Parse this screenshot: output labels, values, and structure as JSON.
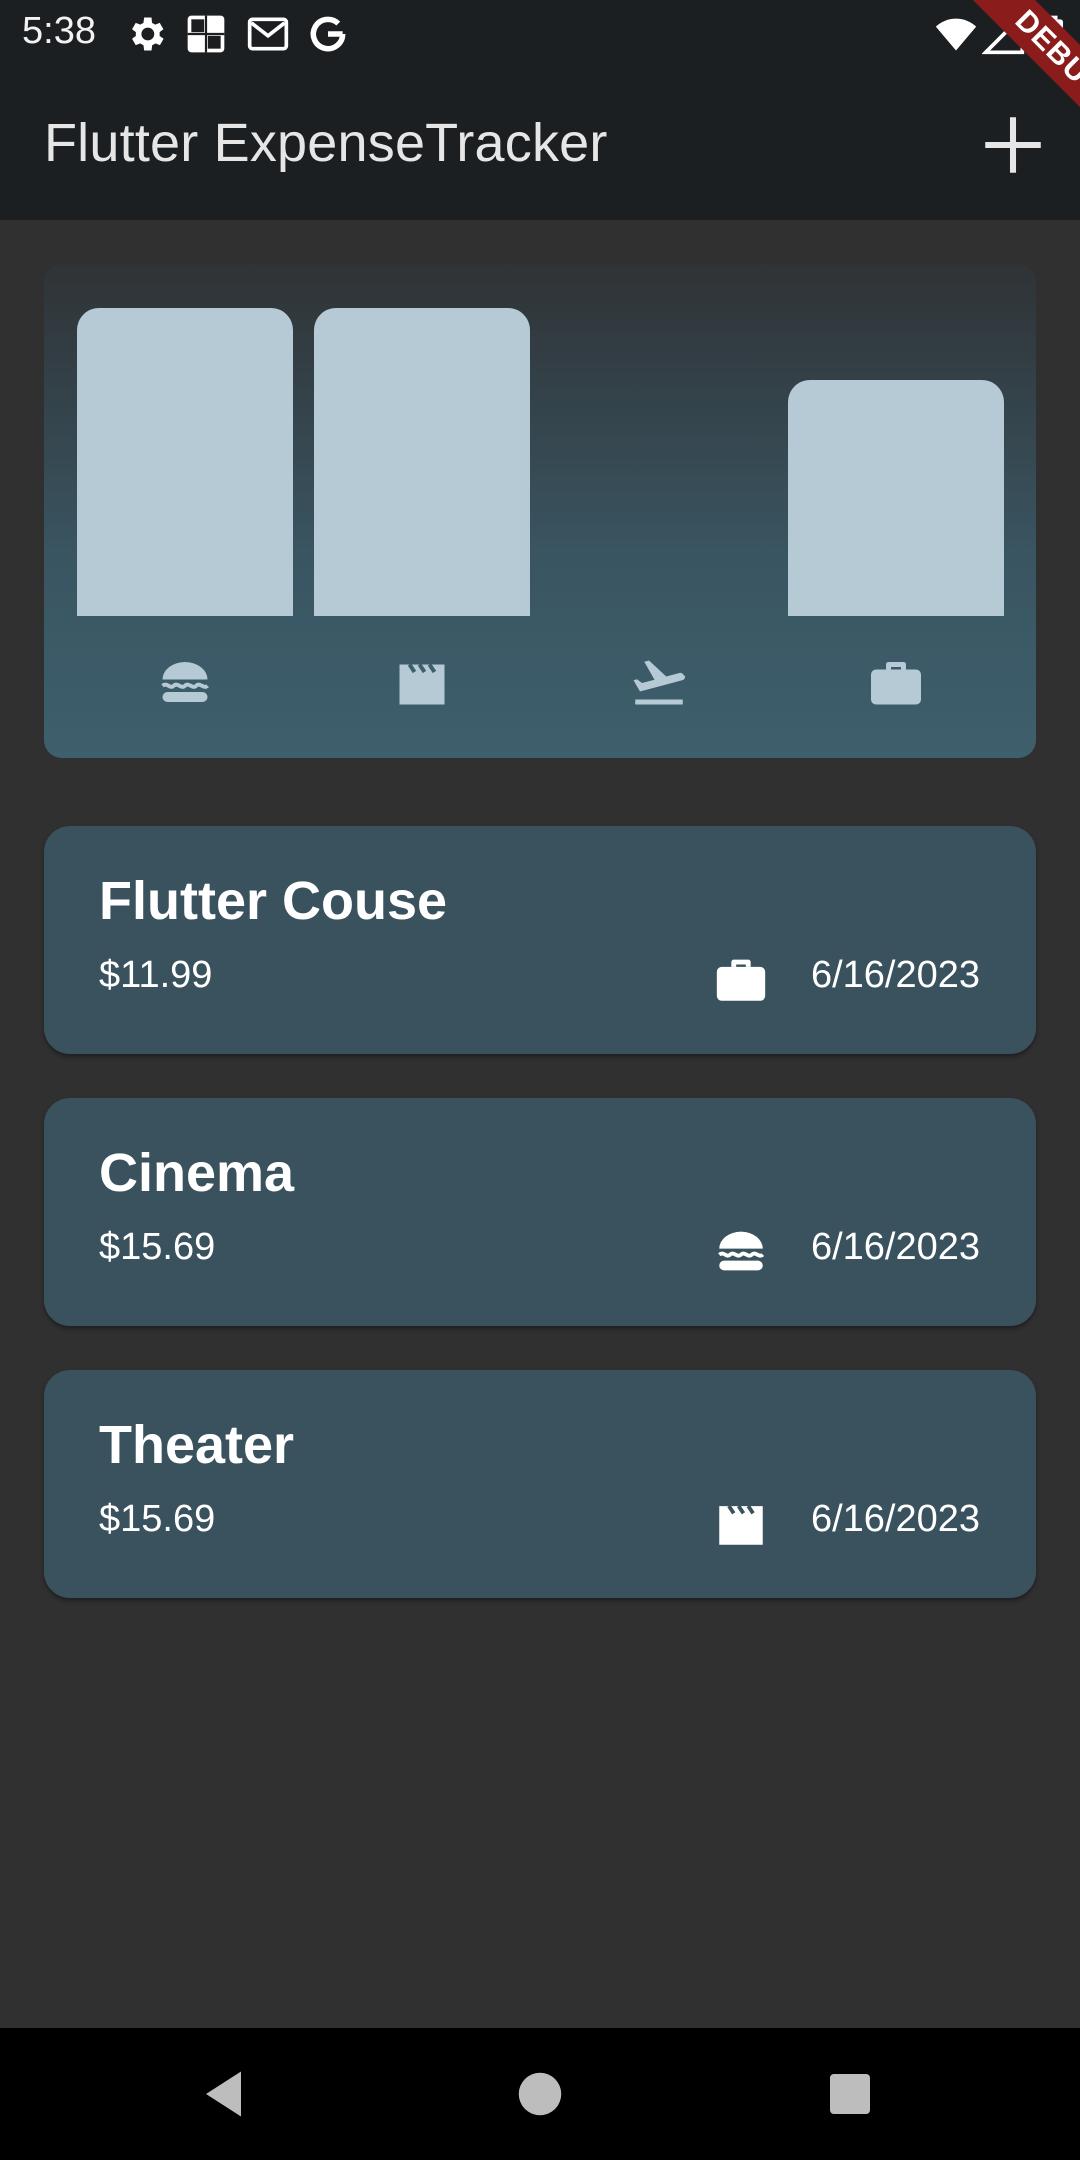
{
  "status_bar": {
    "time": "5:38",
    "icons": [
      "gear-icon",
      "crossword-icon",
      "gmail-icon",
      "google-icon",
      "wifi-icon",
      "cell-signal-icon",
      "battery-icon"
    ]
  },
  "debug_banner": "DEBUG",
  "app_bar": {
    "title": "Flutter ExpenseTracker",
    "action_icon": "add-icon"
  },
  "chart": {
    "categories": [
      "food",
      "leisure",
      "travel",
      "work"
    ],
    "icons": [
      "burger-icon",
      "movie-clapper-icon",
      "flight-takeoff-icon",
      "briefcase-icon"
    ],
    "fill_fractions": [
      1.0,
      1.0,
      0.0,
      0.765
    ],
    "bar_color": "#b5cad5"
  },
  "expenses": [
    {
      "title": "Flutter Couse",
      "amount": "$11.99",
      "date": "6/16/2023",
      "category_icon": "briefcase-icon"
    },
    {
      "title": "Cinema",
      "amount": "$15.69",
      "date": "6/16/2023",
      "category_icon": "burger-icon"
    },
    {
      "title": "Theater",
      "amount": "$15.69",
      "date": "6/16/2023",
      "category_icon": "movie-clapper-icon"
    }
  ],
  "nav_bar": {
    "buttons": [
      "back-button",
      "home-button",
      "recents-button"
    ]
  },
  "colors": {
    "app_bar_bg": "#1c1f21",
    "background": "#303030",
    "card_bg": "#3a525d",
    "accent": "#b5cad5"
  }
}
